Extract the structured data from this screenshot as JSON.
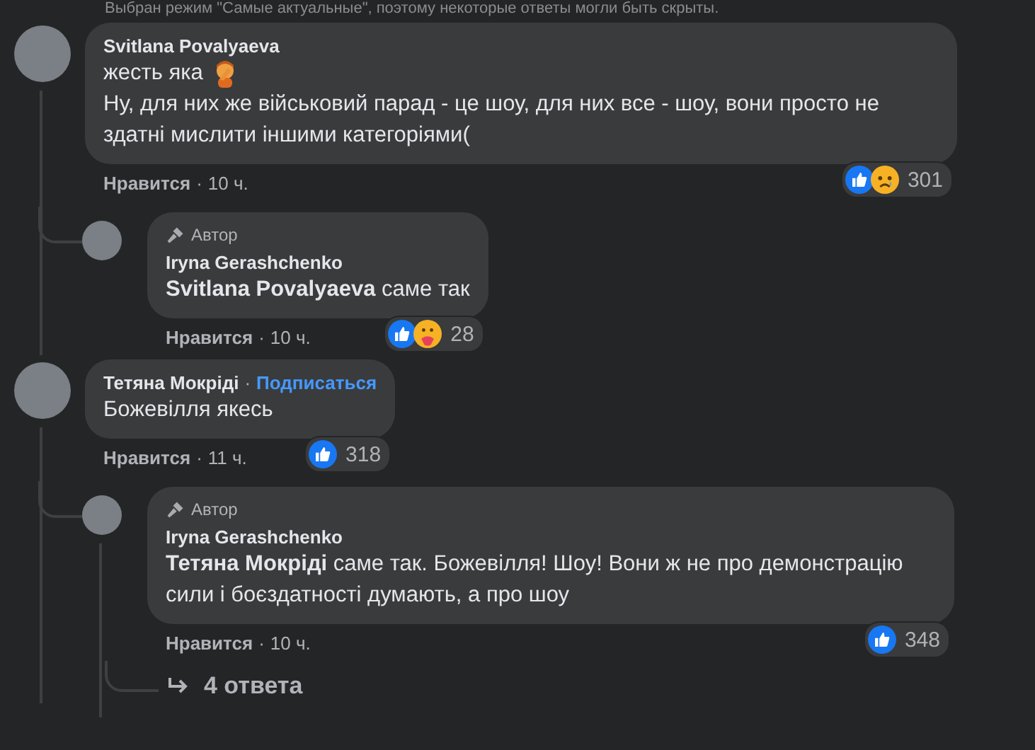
{
  "notice": "Выбран режим \"Самые актуальные\", поэтому некоторые ответы могли быть скрыты.",
  "comments": [
    {
      "author": "Svitlana Povalyaeva",
      "body": [
        {
          "kind": "facepalm",
          "text": "жесть яка"
        },
        {
          "kind": "plain",
          "text": "Ну, для них же військовий парад - це шоу, для них все - шоу, вони просто не здатні мислити іншими категоріями("
        }
      ],
      "reactions": {
        "items": [
          {
            "kind": "like"
          },
          {
            "kind": "sad"
          }
        ],
        "count": "301"
      },
      "like": "Нравится",
      "separator": "·",
      "time": "10 ч.",
      "replies": [
        {
          "badge": "Автор",
          "author": "Iryna Gerashchenko",
          "body": [
            {
              "text": "**Svitlana Povalyaeva** саме так"
            }
          ],
          "reactions": {
            "items": [
              {
                "kind": "like"
              },
              {
                "kind": "care"
              }
            ],
            "count": "28"
          },
          "like": "Нравится",
          "separator": "·",
          "time": "10 ч."
        }
      ]
    },
    {
      "author": "Тетяна Мокріді",
      "follow_separator": "·",
      "follow": "Подписаться",
      "body": [
        {
          "kind": "plain",
          "text": "Божевілля якесь"
        }
      ],
      "reactions": {
        "items": [
          {
            "kind": "like"
          }
        ],
        "count": "318"
      },
      "like": "Нравится",
      "separator": "·",
      "time": "11 ч.",
      "replies": [
        {
          "badge": "Автор",
          "author": "Iryna Gerashchenko",
          "body": [
            {
              "text": "**Тетяна Мокріді** саме так. Божевілля! Шоу! Вони ж не про демонстрацію сили і боєздатності думають, а про шоу"
            }
          ],
          "reactions": {
            "items": [
              {
                "kind": "like"
              }
            ],
            "count": "348"
          },
          "like": "Нравится",
          "separator": "·",
          "time": "10 ч."
        }
      ],
      "more_replies": "4 ответа"
    }
  ]
}
